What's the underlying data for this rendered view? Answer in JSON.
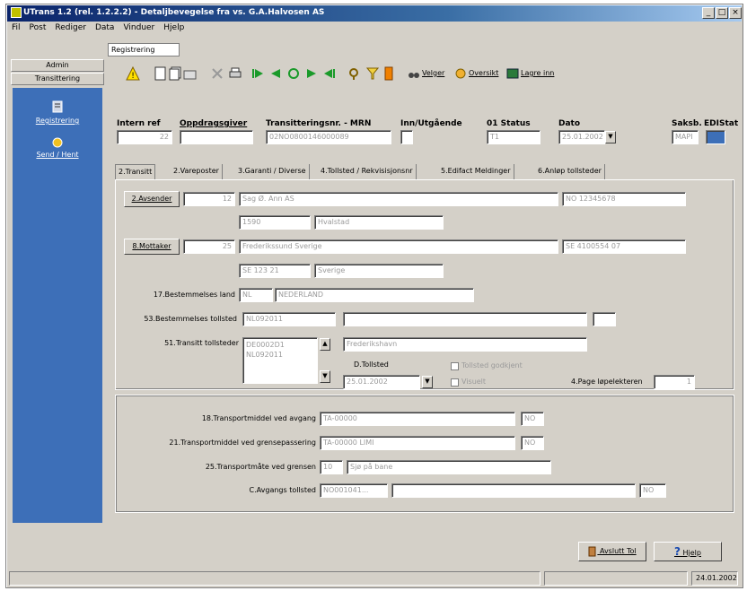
{
  "window": {
    "title": "UTrans 1.2 (rel. 1.2.2.2) - Detaljbevegelse fra vs. G.A.Halvosen AS",
    "min": "_",
    "max": "□",
    "close": "×"
  },
  "menu": [
    "Fil",
    "Post",
    "Rediger",
    "Data",
    "Vinduer",
    "Hjelp"
  ],
  "nav": {
    "tabs": [
      "Admin",
      "Transittering"
    ],
    "items": [
      {
        "label": "Registrering",
        "icon": "form-icon"
      },
      {
        "label": "Send / Hent",
        "icon": "send-receive-icon"
      }
    ]
  },
  "main_tab": "Registrering",
  "toolbar": {
    "buttons": [
      "warning-icon",
      "new-document-icon",
      "copy-document-icon",
      "edit-icon",
      "delete-icon",
      "print-icon",
      "first-record-icon",
      "prev-record-icon",
      "refresh-icon",
      "next-record-icon",
      "last-record-icon",
      "search-icon",
      "filter-icon",
      "bookmark-icon"
    ],
    "text_buttons": [
      {
        "label": "Velger",
        "icon": "binoculars-icon"
      },
      {
        "label": "Oversikt",
        "icon": "list-icon"
      },
      {
        "label": "Lagre inn",
        "icon": "save-icon"
      }
    ]
  },
  "header_fields": {
    "intern_ref": {
      "label": "Intern ref",
      "value": "22"
    },
    "oppdragsgiver": {
      "label": "Oppdragsgiver",
      "value": ""
    },
    "mrn": {
      "label": "Transitteringsnr. - MRN",
      "value": "02NO0800146000089"
    },
    "inn_utg": {
      "label": "Inn/Utgående",
      "value": ""
    },
    "status": {
      "label": "01 Status",
      "value": "T1"
    },
    "dato": {
      "label": "Dato",
      "value": "25.01.2002"
    },
    "saksb": {
      "label": "Saksb.",
      "value": "MAPI"
    },
    "edistat": {
      "label": "EDIStat",
      "value": ""
    }
  },
  "subtabs": [
    "2.Transitt",
    "2.Vareposter",
    "3.Garanti / Diverse",
    "4.Tollsted / Rekvisisjonsnr",
    "5.Edifact Meldinger",
    "6.Anløp tollsteder"
  ],
  "avsender": {
    "button": "2.Avsender",
    "code": "12",
    "name": "Sag Ø. Ann AS",
    "orgnr": "NO 12345678",
    "postnr": "1590",
    "sted": "Hvalstad"
  },
  "mottaker": {
    "button": "8.Mottaker",
    "code": "25",
    "name": "Frederikssund Sverige",
    "orgnr": "SE 4100554 07",
    "postnr": "SE 123 21",
    "sted": "Sverige"
  },
  "bestemmelsesland": {
    "label": "17.Bestemmelses land",
    "code": "NL",
    "name": "NEDERLAND"
  },
  "bestemmelsestollsted": {
    "label": "53.Bestemmelses tollsted",
    "code": "NL092011",
    "name": "",
    "extra": ""
  },
  "transitt_tollsteder": {
    "label": "51.Transitt tollsteder",
    "items": [
      "DE0002D1",
      "NL092011"
    ],
    "name": "Frederikshavn"
  },
  "tollsted": {
    "label": "D.Tollsted",
    "date": "25.01.2002",
    "check1": "Tollsted godkjent",
    "check2": "Visuelt",
    "pages_label": "4.Page løpelekteren",
    "pages_value": "1"
  },
  "transport": {
    "avgang": {
      "label": "18.Transportmiddel ved avgang",
      "value": "TA-00000",
      "code": "NO"
    },
    "grense": {
      "label": "21.Transportmiddel ved grensepassering",
      "value": "TA-00000 LIMI",
      "code": "NO"
    },
    "transportmate": {
      "label": "25.Transportmåte ved grensen",
      "code": "10",
      "name": "Sjø på bane"
    },
    "avgangstollsted": {
      "label": "C.Avgangs tollsted",
      "code": "NO001041...",
      "name": "",
      "country": "NO"
    }
  },
  "footer_buttons": {
    "avslutt": "Avslutt Tol",
    "hjelp": "Hjelp"
  },
  "status": {
    "date": "24.01.2002"
  }
}
